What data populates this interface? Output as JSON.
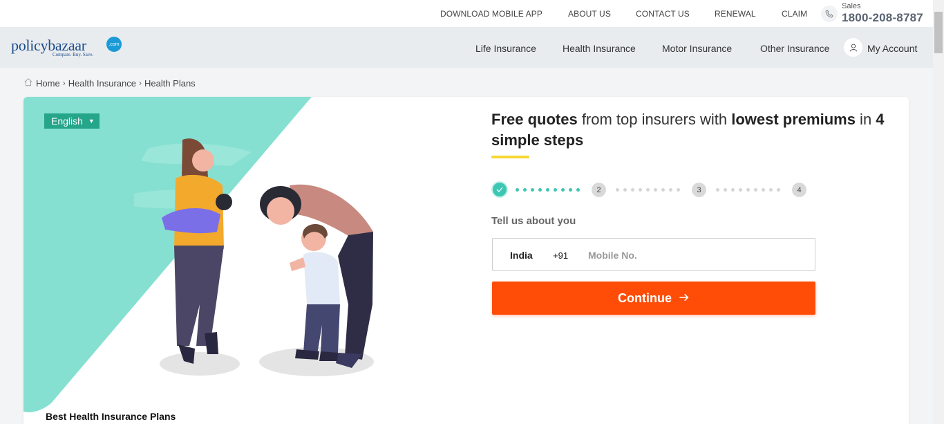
{
  "topbar": {
    "links": [
      "DOWNLOAD MOBILE APP",
      "ABOUT US",
      "CONTACT US",
      "RENEWAL",
      "CLAIM"
    ],
    "sales_label": "Sales",
    "sales_number": "1800-208-8787"
  },
  "logo": {
    "word": "policybazaar",
    "tagline": "Compare. Buy. Save.",
    "badge": ".com"
  },
  "nav": {
    "links": [
      "Life Insurance",
      "Health Insurance",
      "Motor Insurance",
      "Other Insurance"
    ],
    "account": "My Account"
  },
  "breadcrumb": [
    "Home",
    "Health Insurance",
    "Health Plans"
  ],
  "hero": {
    "language": "English",
    "best_plans": "Best Health Insurance Plans"
  },
  "form": {
    "headline_parts": [
      "Free quotes",
      " from top insurers with ",
      "lowest premiums",
      " in ",
      "4 simple steps"
    ],
    "steps": [
      "2",
      "3",
      "4"
    ],
    "section_label": "Tell us about you",
    "country": "India",
    "dial_code": "+91",
    "mobile_placeholder": "Mobile No.",
    "submit": "Continue"
  },
  "colors": {
    "accent_orange": "#ff4d07",
    "teal": "#3cc7b4",
    "brand_blue": "#1b4c8c"
  }
}
